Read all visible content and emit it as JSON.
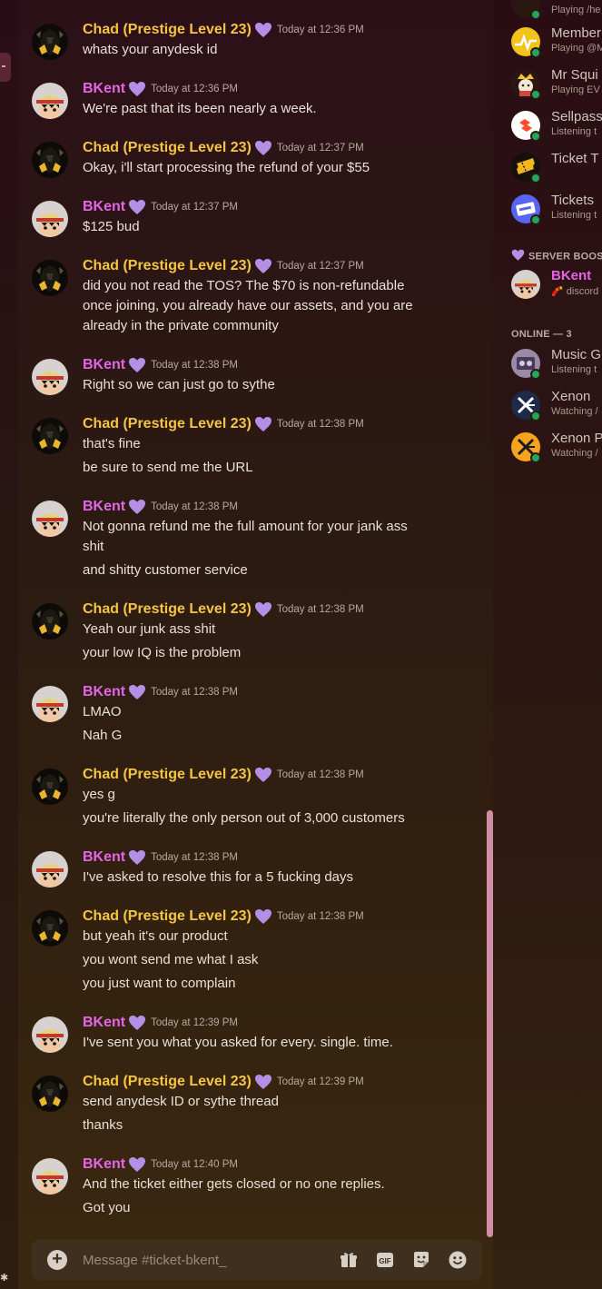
{
  "messages": [
    {
      "author": "Chad (Prestige Level 23)",
      "kind": "chad",
      "time": "Today at 12:36 PM",
      "lines": [
        "whats your anydesk id"
      ]
    },
    {
      "author": "BKent",
      "kind": "bk",
      "time": "Today at 12:36 PM",
      "lines": [
        "We're past that its been nearly a week."
      ]
    },
    {
      "author": "Chad (Prestige Level 23)",
      "kind": "chad",
      "time": "Today at 12:37 PM",
      "lines": [
        "Okay, i'll start processing the refund of your $55"
      ]
    },
    {
      "author": "BKent",
      "kind": "bk",
      "time": "Today at 12:37 PM",
      "lines": [
        "$125 bud"
      ]
    },
    {
      "author": "Chad (Prestige Level 23)",
      "kind": "chad",
      "time": "Today at 12:37 PM",
      "lines": [
        "did you not read the TOS? The $70 is non-refundable once joining, you already have our assets, and you are already in the private community"
      ]
    },
    {
      "author": "BKent",
      "kind": "bk",
      "time": "Today at 12:38 PM",
      "lines": [
        "Right so we can just go to sythe"
      ]
    },
    {
      "author": "Chad (Prestige Level 23)",
      "kind": "chad",
      "time": "Today at 12:38 PM",
      "lines": [
        "that's fine",
        "be sure to send me the URL"
      ]
    },
    {
      "author": "BKent",
      "kind": "bk",
      "time": "Today at 12:38 PM",
      "lines": [
        "Not gonna refund me the full amount for your jank ass shit",
        "and shitty customer service"
      ]
    },
    {
      "author": "Chad (Prestige Level 23)",
      "kind": "chad",
      "time": "Today at 12:38 PM",
      "lines": [
        "Yeah our junk ass shit",
        "your low IQ is the problem"
      ]
    },
    {
      "author": "BKent",
      "kind": "bk",
      "time": "Today at 12:38 PM",
      "lines": [
        "LMAO",
        "Nah G"
      ]
    },
    {
      "author": "Chad (Prestige Level 23)",
      "kind": "chad",
      "time": "Today at 12:38 PM",
      "lines": [
        "yes g",
        "you're literally the only person out of 3,000 customers"
      ]
    },
    {
      "author": "BKent",
      "kind": "bk",
      "time": "Today at 12:38 PM",
      "lines": [
        "I've asked to resolve this for a 5 fucking days"
      ]
    },
    {
      "author": "Chad (Prestige Level 23)",
      "kind": "chad",
      "time": "Today at 12:38 PM",
      "lines": [
        "but yeah it's our product",
        "you wont send me what I ask",
        "you just want to complain"
      ]
    },
    {
      "author": "BKent",
      "kind": "bk",
      "time": "Today at 12:39 PM",
      "lines": [
        "I've sent you what you asked for every. single. time."
      ]
    },
    {
      "author": "Chad (Prestige Level 23)",
      "kind": "chad",
      "time": "Today at 12:39 PM",
      "lines": [
        "send anydesk ID or sythe thread",
        "thanks"
      ]
    },
    {
      "author": "BKent",
      "kind": "bk",
      "time": "Today at 12:40 PM",
      "lines": [
        "And the ticket either gets closed or no one replies.",
        "Got you"
      ]
    }
  ],
  "composer": {
    "placeholder": "Message #ticket-bkent_",
    "icons": [
      "add-icon",
      "gift-icon",
      "gif-icon",
      "sticker-icon",
      "emoji-icon"
    ]
  },
  "members": {
    "top_list": [
      {
        "name": "",
        "activity": "Playing /he",
        "avatar": "space-invader"
      },
      {
        "name": "Member",
        "activity": "Playing @M",
        "avatar": "yellow-chart"
      },
      {
        "name": "Mr Squi",
        "activity": "Playing EV",
        "avatar": "crown-character"
      },
      {
        "name": "Sellpass",
        "activity": "Listening t",
        "avatar": "sellpass-logo"
      },
      {
        "name": "Ticket T",
        "activity": "",
        "avatar": "ticket"
      },
      {
        "name": "Tickets",
        "activity": "Listening t",
        "avatar": "tickets-logo"
      }
    ],
    "booster_heading": "SERVER BOOS",
    "booster": {
      "name": "BKent",
      "activity": "discord"
    },
    "online_heading": "ONLINE — 3",
    "online_list": [
      {
        "name": "Music G",
        "activity": "Listening t",
        "avatar": "music-bot"
      },
      {
        "name": "Xenon",
        "activity": "Watching /",
        "avatar": "xenon-dark"
      },
      {
        "name": "Xenon P",
        "activity": "Watching /",
        "avatar": "xenon-orange"
      }
    ]
  },
  "colors": {
    "chad_name": "#f4c542",
    "bkent_name": "#e466e6",
    "heart": "#b58ee6",
    "online": "#23a55a",
    "scrollbar": "#d28ea6"
  }
}
